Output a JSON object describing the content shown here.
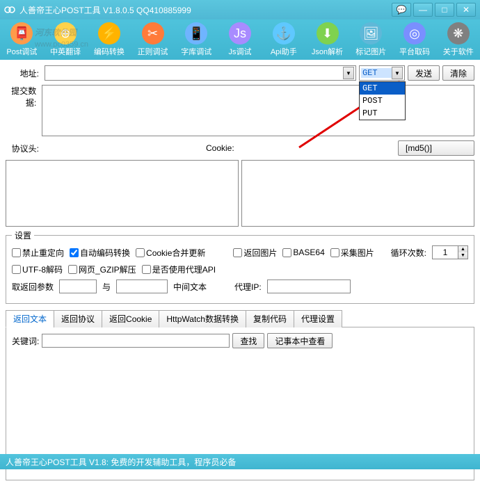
{
  "window": {
    "title": "人善帝王心POST工具 V1.8.0.5 QQ410885999"
  },
  "winbuttons": {
    "chat": "💬",
    "min": "—",
    "max": "□",
    "close": "✕"
  },
  "toolbar": [
    {
      "label": "Post调试",
      "bg": "#ff9b4a",
      "glyph": "📮"
    },
    {
      "label": "中英翻译",
      "bg": "#ffd24a",
      "glyph": "⊕"
    },
    {
      "label": "编码转换",
      "bg": "#ffb300",
      "glyph": "⚡"
    },
    {
      "label": "正则调试",
      "bg": "#ff7b3a",
      "glyph": "✂"
    },
    {
      "label": "字库调试",
      "bg": "#6fb4ff",
      "glyph": "📱"
    },
    {
      "label": "Js调试",
      "bg": "#a88bff",
      "glyph": "Js"
    },
    {
      "label": "Api助手",
      "bg": "#5fc8ff",
      "glyph": "⚓"
    },
    {
      "label": "Json解析",
      "bg": "#7fd24f",
      "glyph": "⬇"
    },
    {
      "label": "标记图片",
      "bg": "#5fb8d8",
      "glyph": "🖼"
    },
    {
      "label": "平台取码",
      "bg": "#7a8fff",
      "glyph": "◎"
    },
    {
      "label": "关于软件",
      "bg": "#808080",
      "glyph": "❋"
    }
  ],
  "watermark": {
    "main": "河东软件园",
    "sub": "www.pc0359.cn"
  },
  "labels": {
    "url": "地址:",
    "postdata": "提交数据:",
    "headers": "协议头:",
    "cookie": "Cookie:",
    "settings": "设置",
    "loops": "循环次数:",
    "paramL": "取返回参数",
    "paramMid": "与",
    "paramR": "中间文本",
    "proxyip": "代理IP:",
    "keyword": "关键词:"
  },
  "buttons": {
    "send": "发送",
    "clear": "清除",
    "md5": "[md5()]",
    "find": "查找",
    "notepad": "记事本中查看"
  },
  "method": {
    "value": "GET",
    "options": [
      "GET",
      "POST",
      "PUT"
    ]
  },
  "checkboxes": {
    "noredirect": "禁止重定向",
    "autoencode": "自动编码转换",
    "cookiemerge": "Cookie合并更新",
    "returnimg": "返回图片",
    "base64": "BASE64",
    "collectimg": "采集图片",
    "utf8": "UTF-8解码",
    "gzip": "网页_GZIP解压",
    "useproxy": "是否使用代理API"
  },
  "checked": {
    "autoencode": true
  },
  "loops_value": "1",
  "tabs": [
    "返回文本",
    "返回协议",
    "返回Cookie",
    "HttpWatch数据转换",
    "复制代码",
    "代理设置"
  ],
  "active_tab": 0,
  "statusbar": "人善帝王心POST工具 V1.8: 免费的开发辅助工具，程序员必备"
}
